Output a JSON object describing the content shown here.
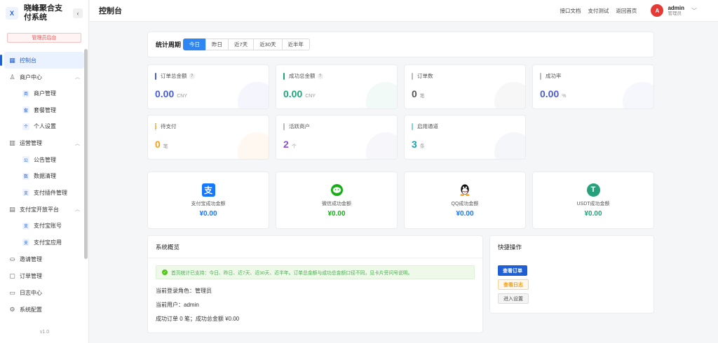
{
  "brand": {
    "logo": "X",
    "title": "晓峰聚合支付系统",
    "collapse_icon": "chevron-left-icon"
  },
  "admin_badge": "管理员后台",
  "nav": {
    "dashboard": "控制台",
    "merchant_center": "商户中心",
    "merchant_sub": [
      {
        "icon": "商",
        "label": "商户管理"
      },
      {
        "icon": "套",
        "label": "套餐管理"
      },
      {
        "icon": "个",
        "label": "个人设置"
      }
    ],
    "operations": "运营管理",
    "operations_sub": [
      {
        "icon": "公",
        "label": "公告管理"
      },
      {
        "icon": "数",
        "label": "数据清理"
      },
      {
        "icon": "支",
        "label": "支付插件管理"
      }
    ],
    "alipay_platform": "支付宝开放平台",
    "alipay_sub": [
      {
        "icon": "支",
        "label": "支付宝账号"
      },
      {
        "icon": "支",
        "label": "支付宝应用"
      }
    ],
    "invite": "邀请管理",
    "orders": "订单管理",
    "logs": "日志中心",
    "settings": "系统配置"
  },
  "version": "v1.0",
  "header": {
    "title": "控制台",
    "links": [
      "接口文档",
      "支付测试",
      "返回首页"
    ],
    "user": {
      "avatar": "A",
      "name": "admin",
      "role": "管理员"
    }
  },
  "period": {
    "label": "统计周期",
    "tabs": [
      "今日",
      "昨日",
      "近7天",
      "近30天",
      "近半年"
    ],
    "active": 0
  },
  "stats": [
    {
      "label": "订单总金额",
      "help": "?",
      "value": "0.00",
      "unit": "CNY",
      "color": "#4a5bd9"
    },
    {
      "label": "成功总金额",
      "help": "?",
      "value": "0.00",
      "unit": "CNY",
      "color": "#1aa87a"
    },
    {
      "label": "订单数",
      "value": "0",
      "unit": "笔",
      "color": "#555555"
    },
    {
      "label": "成功率",
      "value": "0.00",
      "unit": "%",
      "color": "#4a5bd9"
    },
    {
      "label": "待支付",
      "value": "0",
      "unit": "笔",
      "color": "#f0a020"
    },
    {
      "label": "活跃商户",
      "value": "2",
      "unit": "个",
      "color": "#8a4fd6"
    },
    {
      "label": "启用通道",
      "value": "3",
      "unit": "条",
      "color": "#1aa0b0"
    }
  ],
  "payments": [
    {
      "label": "支付宝成功金额",
      "value": "¥0.00",
      "icon": "alipay-icon",
      "glyph": "支",
      "color": "#1677ff"
    },
    {
      "label": "微信成功金额",
      "value": "¥0.00",
      "icon": "wechat-icon",
      "color": "#1aad19"
    },
    {
      "label": "QQ成功金额",
      "value": "¥0.00",
      "icon": "qq-icon",
      "color": "#1677ff"
    },
    {
      "label": "USDT成功金额",
      "value": "¥0.00",
      "icon": "usdt-icon",
      "glyph": "T",
      "color": "#26a17b"
    }
  ],
  "overview": {
    "title": "系统概览",
    "notice": "首页统计已支持：今日、昨日、近7天、近30天、近半年。订单总金额与成功总金额口径不同，见卡片旁问号说明。",
    "role_line": "当前登录角色：管理员",
    "user_line": "当前用户：admin",
    "orders_line": "成功订单 0 笔；成功总金额 ¥0.00"
  },
  "quick": {
    "title": "快捷操作",
    "buttons": [
      "查看订单",
      "查看日志",
      "进入设置"
    ]
  }
}
